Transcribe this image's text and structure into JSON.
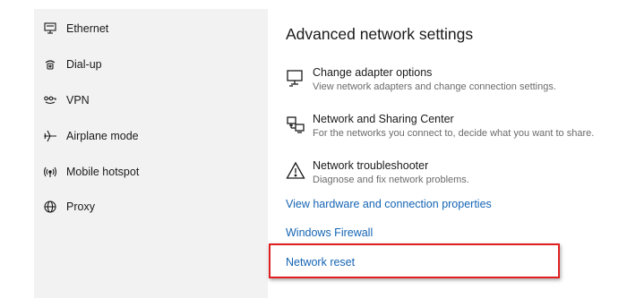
{
  "sidebar": {
    "items": [
      {
        "label": "Ethernet",
        "icon": "ethernet-icon"
      },
      {
        "label": "Dial-up",
        "icon": "dialup-icon"
      },
      {
        "label": "VPN",
        "icon": "vpn-icon"
      },
      {
        "label": "Airplane mode",
        "icon": "airplane-icon"
      },
      {
        "label": "Mobile hotspot",
        "icon": "hotspot-icon"
      },
      {
        "label": "Proxy",
        "icon": "globe-icon"
      }
    ]
  },
  "main": {
    "heading": "Advanced network settings",
    "options": [
      {
        "title": "Change adapter options",
        "desc": "View network adapters and change connection settings.",
        "icon": "monitor-icon"
      },
      {
        "title": "Network and Sharing Center",
        "desc": "For the networks you connect to, decide what you want to share.",
        "icon": "sharing-center-icon"
      },
      {
        "title": "Network troubleshooter",
        "desc": "Diagnose and fix network problems.",
        "icon": "warning-icon"
      }
    ],
    "links": {
      "hardware": "View hardware and connection properties",
      "firewall": "Windows Firewall",
      "reset": "Network reset"
    }
  },
  "colors": {
    "link": "#1464b4",
    "highlight_border": "#e02020",
    "sidebar_bg": "#f2f2f2"
  }
}
